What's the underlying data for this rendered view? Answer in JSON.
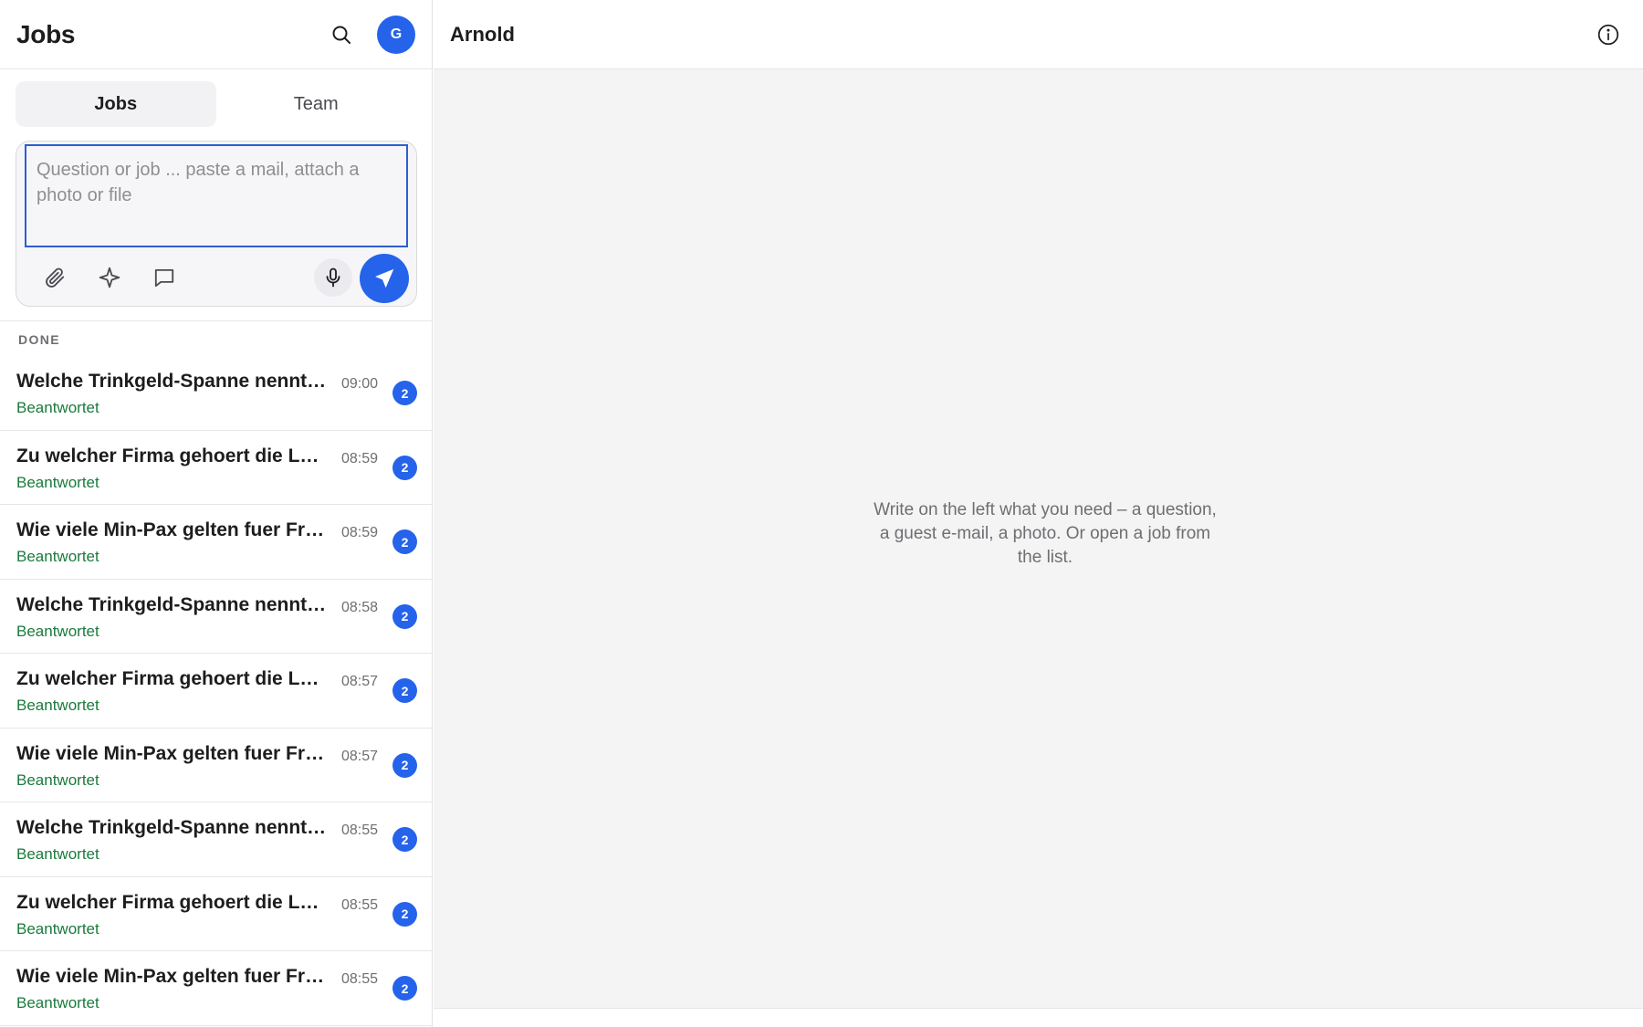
{
  "sidebar": {
    "title": "Jobs",
    "avatar_initial": "G",
    "tabs": [
      {
        "label": "Jobs",
        "active": true
      },
      {
        "label": "Team",
        "active": false
      }
    ],
    "composer": {
      "placeholder": "Question or job ... paste a mail, attach a photo or file",
      "value": ""
    },
    "section_label": "DONE",
    "jobs": [
      {
        "title": "Welche Trinkgeld-Spanne nennt ...",
        "status": "Beantwortet",
        "time": "09:00",
        "count": "2"
      },
      {
        "title": "Zu welcher Firma gehoert die Lea...",
        "status": "Beantwortet",
        "time": "08:59",
        "count": "2"
      },
      {
        "title": "Wie viele Min-Pax gelten fuer Fre...",
        "status": "Beantwortet",
        "time": "08:59",
        "count": "2"
      },
      {
        "title": "Welche Trinkgeld-Spanne nennt ...",
        "status": "Beantwortet",
        "time": "08:58",
        "count": "2"
      },
      {
        "title": "Zu welcher Firma gehoert die Lea...",
        "status": "Beantwortet",
        "time": "08:57",
        "count": "2"
      },
      {
        "title": "Wie viele Min-Pax gelten fuer Fre...",
        "status": "Beantwortet",
        "time": "08:57",
        "count": "2"
      },
      {
        "title": "Welche Trinkgeld-Spanne nennt ...",
        "status": "Beantwortet",
        "time": "08:55",
        "count": "2"
      },
      {
        "title": "Zu welcher Firma gehoert die Lea...",
        "status": "Beantwortet",
        "time": "08:55",
        "count": "2"
      },
      {
        "title": "Wie viele Min-Pax gelten fuer Fre...",
        "status": "Beantwortet",
        "time": "08:55",
        "count": "2"
      }
    ]
  },
  "main": {
    "title": "Arnold",
    "empty_message": "Write on the left what you need – a question, a guest e-mail, a photo. Or open a job from the list."
  },
  "colors": {
    "accent": "#2563eb",
    "status_done": "#1a7a3c",
    "main_background": "#f4f4f4"
  },
  "icons": [
    "search-icon",
    "paperclip-icon",
    "sparkle-icon",
    "comment-icon",
    "microphone-icon",
    "send-icon",
    "info-icon"
  ]
}
